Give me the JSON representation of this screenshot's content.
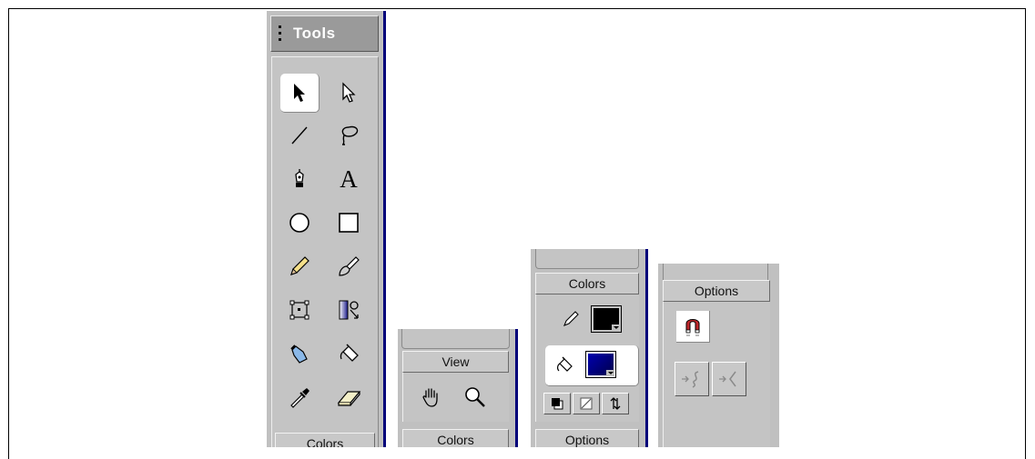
{
  "tools_panel": {
    "title": "Tools",
    "tools": [
      {
        "name": "arrow-tool",
        "icon": "arrow-icon",
        "active": true
      },
      {
        "name": "subselect-tool",
        "icon": "subselect-arrow-icon"
      },
      {
        "name": "line-tool",
        "icon": "line-icon"
      },
      {
        "name": "lasso-tool",
        "icon": "lasso-icon"
      },
      {
        "name": "pen-tool",
        "icon": "pen-icon"
      },
      {
        "name": "text-tool",
        "icon": "text-icon",
        "glyph": "A"
      },
      {
        "name": "oval-tool",
        "icon": "oval-icon"
      },
      {
        "name": "rectangle-tool",
        "icon": "rectangle-icon"
      },
      {
        "name": "pencil-tool",
        "icon": "pencil-icon"
      },
      {
        "name": "brush-tool",
        "icon": "brush-icon"
      },
      {
        "name": "free-transform-tool",
        "icon": "free-transform-icon"
      },
      {
        "name": "fill-transform-tool",
        "icon": "fill-transform-icon"
      },
      {
        "name": "ink-bottle-tool",
        "icon": "ink-bottle-icon"
      },
      {
        "name": "paint-bucket-tool",
        "icon": "paint-bucket-icon"
      },
      {
        "name": "eyedropper-tool",
        "icon": "eyedropper-icon"
      },
      {
        "name": "eraser-tool",
        "icon": "eraser-icon"
      }
    ],
    "bottom_section": "Colors"
  },
  "view_panel": {
    "title": "View",
    "tools": [
      {
        "name": "hand-tool",
        "icon": "hand-icon"
      },
      {
        "name": "zoom-tool",
        "icon": "zoom-icon"
      }
    ],
    "next_section": "Colors"
  },
  "colors_panel": {
    "title": "Colors",
    "stroke_color": "#000000",
    "fill_color": "#000080",
    "buttons": [
      "default-colors-icon",
      "no-color-icon",
      "swap-colors-icon"
    ],
    "next_section": "Options"
  },
  "options_panel": {
    "title": "Options",
    "buttons": [
      "snap-to-objects-icon",
      "smooth-icon",
      "straighten-icon"
    ]
  },
  "colors": {
    "panel_bg": "#c0c0c0",
    "accent_navy": "#00007a"
  }
}
